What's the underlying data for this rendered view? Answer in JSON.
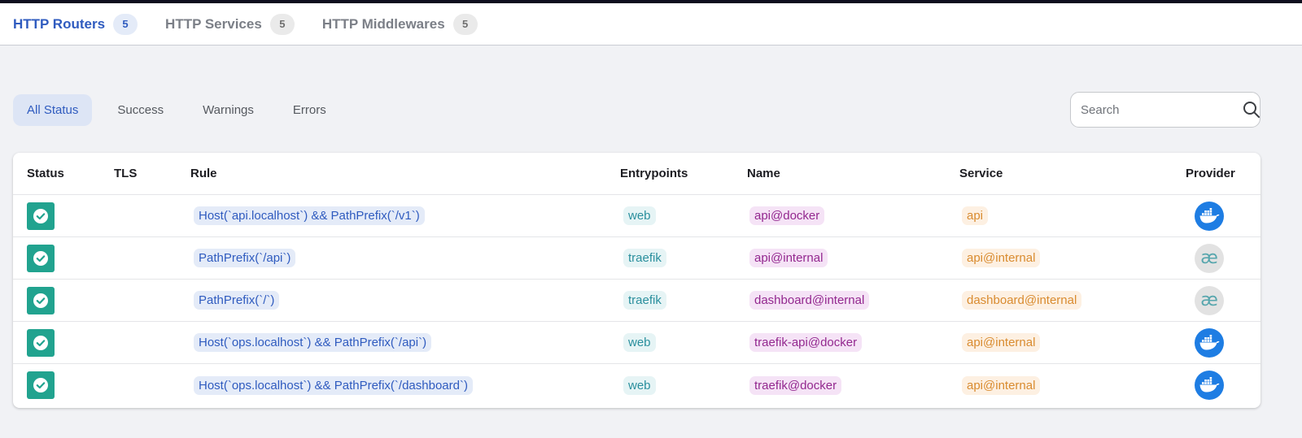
{
  "tabs": [
    {
      "label": "HTTP Routers",
      "count": "5"
    },
    {
      "label": "HTTP Services",
      "count": "5"
    },
    {
      "label": "HTTP Middlewares",
      "count": "5"
    }
  ],
  "filters": [
    "All Status",
    "Success",
    "Warnings",
    "Errors"
  ],
  "search": {
    "placeholder": "Search"
  },
  "columns": {
    "status": "Status",
    "tls": "TLS",
    "rule": "Rule",
    "entrypoints": "Entrypoints",
    "name": "Name",
    "service": "Service",
    "provider": "Provider"
  },
  "rows": [
    {
      "status": "success",
      "tls": "",
      "rule": "Host(`api.localhost`) && PathPrefix(`/v1`)",
      "entrypoints": "web",
      "name": "api@docker",
      "service": "api",
      "provider": "docker"
    },
    {
      "status": "success",
      "tls": "",
      "rule": "PathPrefix(`/api`)",
      "entrypoints": "traefik",
      "name": "api@internal",
      "service": "api@internal",
      "provider": "internal"
    },
    {
      "status": "success",
      "tls": "",
      "rule": "PathPrefix(`/`)",
      "entrypoints": "traefik",
      "name": "dashboard@internal",
      "service": "dashboard@internal",
      "provider": "internal"
    },
    {
      "status": "success",
      "tls": "",
      "rule": "Host(`ops.localhost`) && PathPrefix(`/api`)",
      "entrypoints": "web",
      "name": "traefik-api@docker",
      "service": "api@internal",
      "provider": "docker"
    },
    {
      "status": "success",
      "tls": "",
      "rule": "Host(`ops.localhost`) && PathPrefix(`/dashboard`)",
      "entrypoints": "web",
      "name": "traefik@docker",
      "service": "api@internal",
      "provider": "docker"
    }
  ],
  "provider_glyphs": {
    "internal": "æ"
  },
  "colors": {
    "accent": "#2f5bbf",
    "success": "#21a38f",
    "docker": "#1e7de3"
  }
}
